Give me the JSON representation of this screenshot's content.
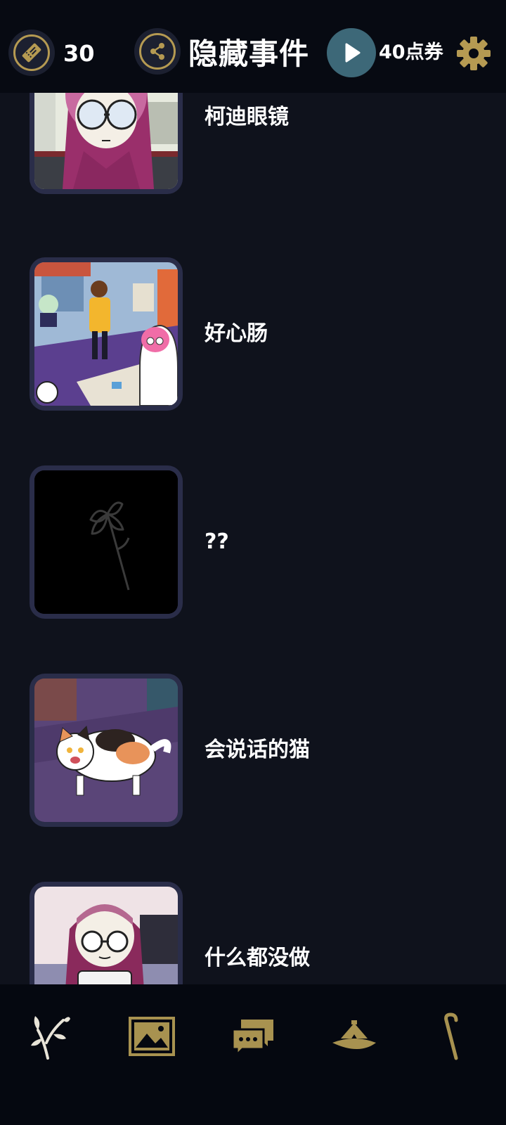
{
  "header": {
    "ticket_icon": "ticket-icon",
    "ticket_count": "30",
    "share_icon": "share-icon",
    "title": "隐藏事件",
    "play_icon": "play-icon",
    "points_label": "40点券",
    "settings_icon": "gear-icon"
  },
  "events": [
    {
      "name": "柯迪眼镜",
      "thumbnail": "girl-with-round-glasses-illustration"
    },
    {
      "name": "好心肠",
      "thumbnail": "messy-room-scene-illustration"
    },
    {
      "name": "??",
      "thumbnail": "locked-flower-silhouette"
    },
    {
      "name": "会说话的猫",
      "thumbnail": "calico-cat-illustration"
    },
    {
      "name": "什么都没做",
      "thumbnail": "girl-in-hood-illustration"
    }
  ],
  "bottom_nav": {
    "items": [
      {
        "icon": "flower-branch-icon"
      },
      {
        "icon": "gallery-icon"
      },
      {
        "icon": "chat-icon"
      },
      {
        "icon": "hat-icon"
      },
      {
        "icon": "cane-icon"
      }
    ]
  },
  "colors": {
    "background": "#0f121c",
    "header_bg": "#070a12",
    "accent_gold": "#b59a52",
    "play_button": "#3d6878",
    "thumb_frame": "#2a2d49"
  }
}
